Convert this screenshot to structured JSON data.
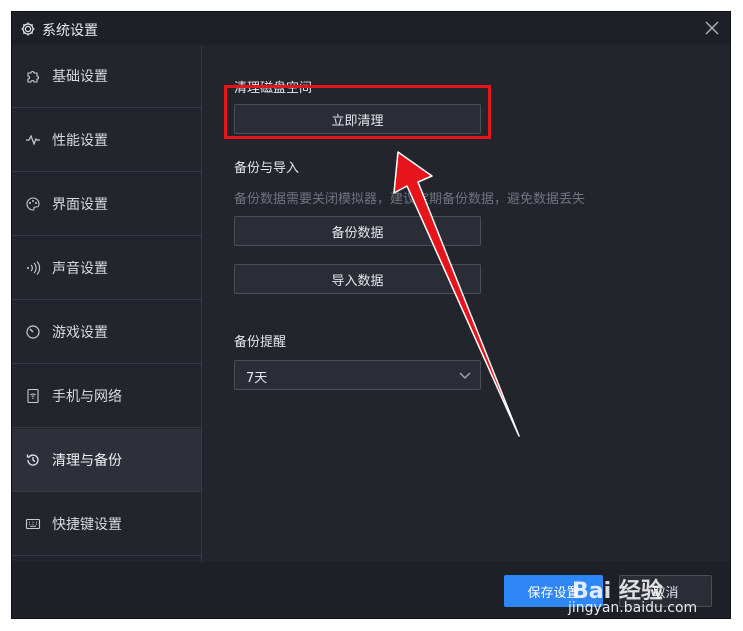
{
  "window": {
    "title": "系统设置"
  },
  "sidebar": {
    "items": [
      {
        "label": "基础设置",
        "icon": "puzzle-icon"
      },
      {
        "label": "性能设置",
        "icon": "pulse-icon"
      },
      {
        "label": "界面设置",
        "icon": "palette-icon"
      },
      {
        "label": "声音设置",
        "icon": "sound-wave-icon"
      },
      {
        "label": "游戏设置",
        "icon": "gauge-icon"
      },
      {
        "label": "手机与网络",
        "icon": "wifi-phone-icon"
      },
      {
        "label": "清理与备份",
        "icon": "history-icon",
        "active": true
      },
      {
        "label": "快捷键设置",
        "icon": "keyboard-icon"
      }
    ]
  },
  "main": {
    "disk_heading": "清理磁盘空间",
    "clean_now_label": "立即清理",
    "backup_heading": "备份与导入",
    "backup_hint": "备份数据需要关闭模拟器，建议定期备份数据，避免数据丢失",
    "backup_label": "备份数据",
    "import_label": "导入数据",
    "reminder_heading": "备份提醒",
    "reminder_value": "7天"
  },
  "footer": {
    "save_label": "保存设置",
    "cancel_label": "取消"
  },
  "watermark": {
    "logo": "Bai 经验",
    "url": "jingyan.baidu.com"
  },
  "colors": {
    "accent": "#2f86f6",
    "highlight": "#e8141c",
    "window_bg": "#23252d"
  }
}
